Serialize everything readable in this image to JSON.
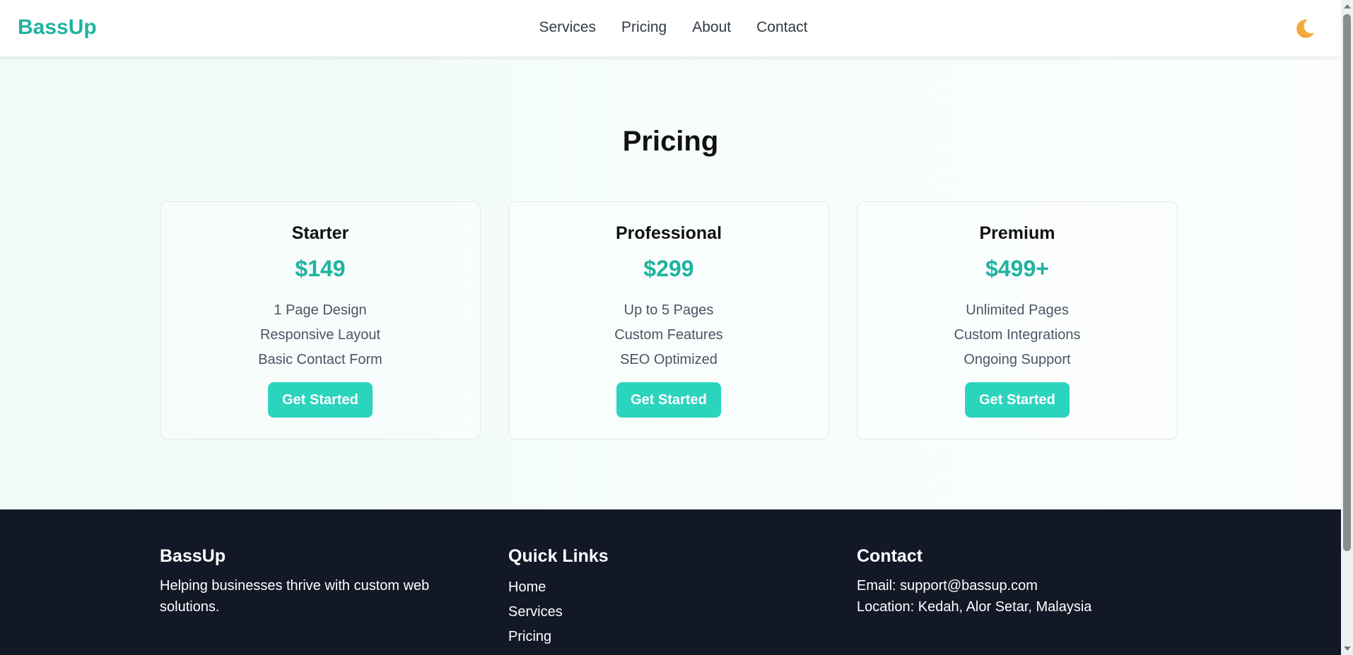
{
  "header": {
    "logo": "BassUp",
    "nav": [
      "Services",
      "Pricing",
      "About",
      "Contact"
    ],
    "theme_toggle_icon": "moon-icon"
  },
  "pricing": {
    "title": "Pricing",
    "plans": [
      {
        "name": "Starter",
        "price": "$149",
        "features": [
          "1 Page Design",
          "Responsive Layout",
          "Basic Contact Form"
        ],
        "cta": "Get Started"
      },
      {
        "name": "Professional",
        "price": "$299",
        "features": [
          "Up to 5 Pages",
          "Custom Features",
          "SEO Optimized"
        ],
        "cta": "Get Started"
      },
      {
        "name": "Premium",
        "price": "$499+",
        "features": [
          "Unlimited Pages",
          "Custom Integrations",
          "Ongoing Support"
        ],
        "cta": "Get Started"
      }
    ]
  },
  "footer": {
    "brand": {
      "title": "BassUp",
      "text": "Helping businesses thrive with custom web solutions."
    },
    "quick_links": {
      "title": "Quick Links",
      "links": [
        "Home",
        "Services",
        "Pricing"
      ]
    },
    "contact": {
      "title": "Contact",
      "email": "Email: support@bassup.com",
      "location": "Location: Kedah, Alor Setar, Malaysia"
    }
  },
  "colors": {
    "accent": "#1fb3a0",
    "button": "#2bd4bd",
    "footer_bg": "#121826"
  }
}
